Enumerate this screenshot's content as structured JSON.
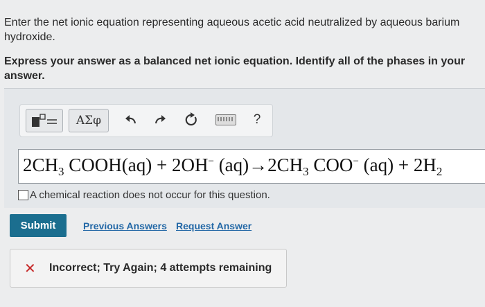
{
  "question": {
    "prompt": "Enter the net ionic equation representing aqueous acetic acid neutralized by aqueous barium hydroxide.",
    "instruction": "Express your answer as a balanced net ionic equation. Identify all of the phases in your answer."
  },
  "toolbar": {
    "greek_label": "ΑΣφ",
    "help_label": "?"
  },
  "equation": {
    "p1": "2CH",
    "s1": "3",
    "p2": " COOH(aq) + 2OH",
    "sup1": "−",
    "p3": " (aq)→2CH",
    "s2": "3",
    "p4": " COO",
    "sup2": "−",
    "p5": " (aq) + 2H",
    "s3": "2"
  },
  "no_reaction_label": "A chemical reaction does not occur for this question.",
  "actions": {
    "submit": "Submit",
    "previous_answers": "Previous Answers",
    "request_answer": "Request Answer"
  },
  "feedback": {
    "icon": "x-icon",
    "text": "Incorrect; Try Again; 4 attempts remaining",
    "color": "#c62828"
  }
}
